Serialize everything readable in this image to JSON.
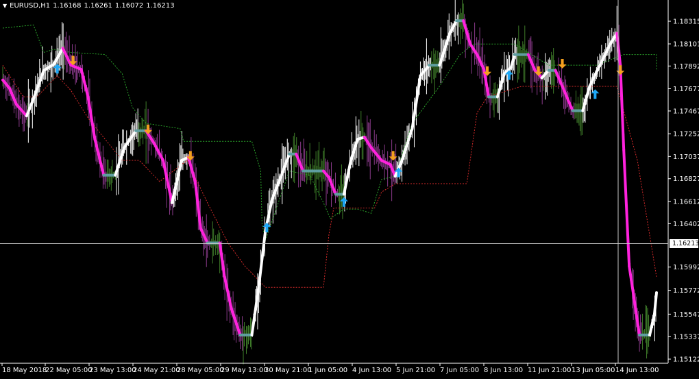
{
  "header": {
    "menu_icon": "triangle-down-icon",
    "symbol": "EURUSD,H1",
    "open": "1.16168",
    "high": "1.16261",
    "low": "1.16072",
    "close": "1.16213"
  },
  "price_axis": {
    "labels": [
      "1.18315",
      "1.18101",
      "1.17892",
      "1.17677",
      "1.17467",
      "1.17252",
      "1.17037",
      "1.16827",
      "1.16612",
      "1.16402",
      "1.15992",
      "1.15772",
      "1.15547",
      "1.15337",
      "1.15122"
    ],
    "label_values": [
      1.18315,
      1.18101,
      1.17892,
      1.17677,
      1.17467,
      1.17252,
      1.17037,
      1.16827,
      1.16612,
      1.16402,
      1.15992,
      1.15772,
      1.15547,
      1.15337,
      1.15122
    ],
    "current_price": "1.16213",
    "current_value": 1.16213
  },
  "time_axis": {
    "labels": [
      "18 May 2018",
      "22 May 05:00",
      "23 May 13:00",
      "24 May 21:00",
      "28 May 05:00",
      "29 May 13:00",
      "30 May 21:00",
      "1 Jun 05:00",
      "4 Jun 13:00",
      "5 Jun 21:00",
      "7 Jun 05:00",
      "8 Jun 13:00",
      "11 Jun 21:00",
      "13 Jun 05:00",
      "14 Jun 13:00"
    ]
  },
  "colors": {
    "background": "#000000",
    "axis": "#ffffff",
    "bull_bar": "#ffffff",
    "bear_bar": "#8a3a8a",
    "neutral_bar": "#3f7d2a",
    "trend_up": "#ffffff",
    "trend_down": "#ff22dd",
    "trend_flat": "#5f9ea0",
    "upper_band": "#2aa32a",
    "lower_band": "#d42a2a",
    "buy_arrow": "#1ea7f5",
    "sell_arrow": "#f5a01e"
  },
  "signals": {
    "buy_icon": "arrow-up-icon",
    "sell_icon": "arrow-down-icon"
  },
  "chart_data": {
    "type": "line",
    "x_axis": "bar index",
    "trend_line": [
      [
        0,
        1.1776
      ],
      [
        10,
        1.1768
      ],
      [
        20,
        1.1753
      ],
      [
        35,
        1.1742
      ],
      [
        45,
        1.1758
      ],
      [
        60,
        1.1785
      ],
      [
        75,
        1.1791
      ],
      [
        88,
        1.1806
      ],
      [
        100,
        1.179
      ],
      [
        115,
        1.1786
      ],
      [
        125,
        1.176
      ],
      [
        135,
        1.172
      ],
      [
        148,
        1.1686
      ],
      [
        165,
        1.1686
      ],
      [
        178,
        1.1712
      ],
      [
        195,
        1.1728
      ],
      [
        210,
        1.1728
      ],
      [
        222,
        1.1716
      ],
      [
        235,
        1.17
      ],
      [
        248,
        1.166
      ],
      [
        262,
        1.17
      ],
      [
        272,
        1.1703
      ],
      [
        282,
        1.168
      ],
      [
        290,
        1.1636
      ],
      [
        300,
        1.1622
      ],
      [
        318,
        1.1622
      ],
      [
        325,
        1.159
      ],
      [
        335,
        1.156
      ],
      [
        348,
        1.1535
      ],
      [
        365,
        1.1535
      ],
      [
        375,
        1.158
      ],
      [
        385,
        1.1634
      ],
      [
        395,
        1.1664
      ],
      [
        405,
        1.168
      ],
      [
        420,
        1.1706
      ],
      [
        430,
        1.1706
      ],
      [
        440,
        1.169
      ],
      [
        470,
        1.169
      ],
      [
        478,
        1.1684
      ],
      [
        488,
        1.1668
      ],
      [
        500,
        1.1668
      ],
      [
        510,
        1.17
      ],
      [
        520,
        1.172
      ],
      [
        530,
        1.1722
      ],
      [
        540,
        1.1712
      ],
      [
        555,
        1.17
      ],
      [
        568,
        1.1696
      ],
      [
        575,
        1.1685
      ],
      [
        585,
        1.17
      ],
      [
        600,
        1.173
      ],
      [
        612,
        1.178
      ],
      [
        625,
        1.179
      ],
      [
        640,
        1.179
      ],
      [
        655,
        1.182
      ],
      [
        665,
        1.1832
      ],
      [
        675,
        1.1832
      ],
      [
        685,
        1.181
      ],
      [
        695,
        1.18
      ],
      [
        705,
        1.1786
      ],
      [
        712,
        1.176
      ],
      [
        725,
        1.176
      ],
      [
        735,
        1.1782
      ],
      [
        745,
        1.1788
      ],
      [
        750,
        1.18
      ],
      [
        770,
        1.18
      ],
      [
        780,
        1.1785
      ],
      [
        790,
        1.1778
      ],
      [
        800,
        1.1785
      ],
      [
        810,
        1.1785
      ],
      [
        820,
        1.177
      ],
      [
        835,
        1.1747
      ],
      [
        850,
        1.1747
      ],
      [
        860,
        1.177
      ],
      [
        875,
        1.179
      ],
      [
        890,
        1.181
      ],
      [
        900,
        1.182
      ],
      [
        905,
        1.179
      ],
      [
        910,
        1.171
      ],
      [
        918,
        1.16
      ],
      [
        925,
        1.157
      ],
      [
        933,
        1.1535
      ],
      [
        948,
        1.1535
      ],
      [
        955,
        1.1555
      ],
      [
        958,
        1.1575
      ]
    ],
    "upper_band": [
      [
        0,
        1.1825
      ],
      [
        45,
        1.1828
      ],
      [
        60,
        1.1802
      ],
      [
        75,
        1.1805
      ],
      [
        100,
        1.1802
      ],
      [
        150,
        1.18
      ],
      [
        175,
        1.1782
      ],
      [
        190,
        1.175
      ],
      [
        210,
        1.1735
      ],
      [
        260,
        1.173
      ],
      [
        265,
        1.1718
      ],
      [
        365,
        1.1718
      ],
      [
        378,
        1.169
      ],
      [
        380,
        1.164
      ],
      [
        385,
        1.1625
      ],
      [
        420,
        1.169
      ],
      [
        450,
        1.1686
      ],
      [
        470,
        1.166
      ],
      [
        480,
        1.1645
      ],
      [
        500,
        1.1654
      ],
      [
        520,
        1.1654
      ],
      [
        540,
        1.165
      ],
      [
        555,
        1.1682
      ],
      [
        575,
        1.1685
      ],
      [
        600,
        1.1735
      ],
      [
        640,
        1.177
      ],
      [
        670,
        1.18
      ],
      [
        690,
        1.181
      ],
      [
        750,
        1.181
      ],
      [
        800,
        1.179
      ],
      [
        855,
        1.179
      ],
      [
        870,
        1.179
      ],
      [
        910,
        1.18
      ],
      [
        958,
        1.18
      ],
      [
        958,
        1.1785
      ]
    ],
    "lower_band": [
      [
        0,
        1.179
      ],
      [
        30,
        1.176
      ],
      [
        50,
        1.176
      ],
      [
        80,
        1.178
      ],
      [
        100,
        1.1766
      ],
      [
        125,
        1.174
      ],
      [
        150,
        1.172
      ],
      [
        175,
        1.17
      ],
      [
        200,
        1.17
      ],
      [
        230,
        1.168
      ],
      [
        270,
        1.17
      ],
      [
        300,
        1.166
      ],
      [
        330,
        1.1622
      ],
      [
        355,
        1.16
      ],
      [
        385,
        1.158
      ],
      [
        470,
        1.158
      ],
      [
        478,
        1.163
      ],
      [
        485,
        1.1655
      ],
      [
        545,
        1.1655
      ],
      [
        555,
        1.167
      ],
      [
        575,
        1.1678
      ],
      [
        680,
        1.1678
      ],
      [
        695,
        1.1745
      ],
      [
        710,
        1.176
      ],
      [
        760,
        1.177
      ],
      [
        780,
        1.177
      ],
      [
        835,
        1.177
      ],
      [
        900,
        1.177
      ],
      [
        930,
        1.17
      ],
      [
        958,
        1.159
      ]
    ],
    "buy_signals": [
      [
        80,
        1.1786
      ],
      [
        387,
        1.1636
      ],
      [
        500,
        1.166
      ],
      [
        580,
        1.1688
      ],
      [
        742,
        1.178
      ],
      [
        868,
        1.1762
      ]
    ],
    "sell_signals": [
      [
        103,
        1.1795
      ],
      [
        213,
        1.173
      ],
      [
        275,
        1.1705
      ],
      [
        572,
        1.1705
      ],
      [
        710,
        1.1785
      ],
      [
        785,
        1.1785
      ],
      [
        820,
        1.1792
      ],
      [
        905,
        1.1786
      ]
    ],
    "current_price": 1.16213,
    "ylim": [
      1.151,
      1.1845
    ]
  }
}
